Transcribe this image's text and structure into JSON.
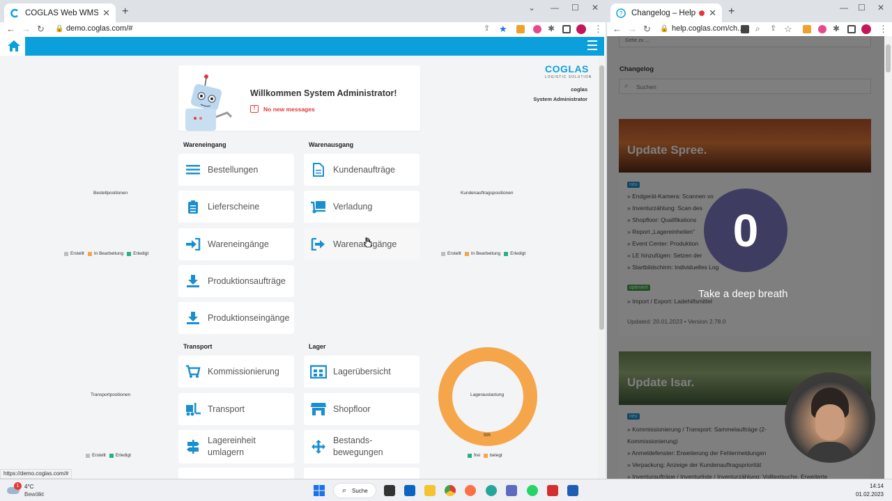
{
  "left_browser": {
    "tab_title": "COGLAS Web WMS",
    "url": "demo.coglas.com/#",
    "status_url": "https://demo.coglas.com/#"
  },
  "right_browser": {
    "tab_title": "Changelog – HelpCenter",
    "url": "help.coglas.com/ch..."
  },
  "welcome": {
    "title": "Willkommen System Administrator!",
    "messages": "No new messages"
  },
  "brand": {
    "logo": "COGLAS",
    "tagline": "LOGISTIC SOLUTION",
    "user": "coglas",
    "role": "System Administrator"
  },
  "sections": {
    "inbound": "Wareneingang",
    "outbound": "Warenausgang",
    "transport": "Transport",
    "storage": "Lager"
  },
  "tiles": {
    "bestellungen": "Bestellungen",
    "lieferscheine": "Lieferscheine",
    "wareneingaenge": "Wareneingänge",
    "produktionsauftraege": "Produktionsaufträge",
    "produktionseingaenge": "Produktionseingänge",
    "kundenauftraege": "Kundenaufträge",
    "verladung": "Verladung",
    "warenausgaenge": "Warenausgänge",
    "kommissionierung": "Kommissionierung",
    "transport": "Transport",
    "lageruebersicht": "Lagerübersicht",
    "shopfloor": "Shopfloor",
    "lagereinheit_umlagern": "Lagereinheit umlagern",
    "bestandsbewegungen": "Bestands-bewegungen"
  },
  "charts": {
    "bestellpositionen": {
      "label": "Bestellpositionen",
      "legend": [
        "Erstellt",
        "In Bearbeitung",
        "Erledigt"
      ]
    },
    "kundenauftragspositionen": {
      "label": "Kundenauftragspositionen",
      "legend": [
        "Erstellt",
        "In Bearbeitung",
        "Erledigt"
      ]
    },
    "transportpositionen": {
      "label": "Transportpositionen",
      "legend": [
        "Erstellt",
        "Erledigt"
      ]
    },
    "lagerauslastung": {
      "label": "Lagerauslastung",
      "value_label": "995",
      "legend": [
        "frei",
        "belegt"
      ]
    }
  },
  "chart_data": {
    "type": "pie",
    "title": "Lagerauslastung",
    "labels": [
      "frei",
      "belegt"
    ],
    "values": [
      0,
      995
    ],
    "colors": [
      "#26b08a",
      "#f5a54a"
    ]
  },
  "colors": {
    "accent": "#0ba0dc",
    "erstellt": "#bdbdbd",
    "in_bearbeitung": "#f5a54a",
    "erledigt": "#26b08a"
  },
  "help": {
    "goto_placeholder": "Gehe zu ...",
    "heading": "Changelog",
    "search_placeholder": "Suchen",
    "post1": {
      "title": "Update Spree.",
      "badge_new": "neu",
      "items": [
        "» Endgerät-Kamera: Scannen vo",
        "» Inventurzählung: Scan des",
        "» Shopfloor: Qualifikations",
        "» Report „Lagereinheiten\"",
        "» Event Center: Produktion",
        "» LE hinzufügen: Setzen der",
        "» Startbildschirm: Individuelles Log"
      ],
      "badge_opt": "optimiert",
      "opt_item": "» Import / Export: Ladehilfsmittel",
      "meta": "Updated: 20.01.2023 • Version 2.78.0"
    },
    "post2": {
      "title": "Update Isar.",
      "badge_new": "neu",
      "items": [
        "» Kommissionierung / Transport: Sammelaufträge (2-",
        "Kommissionierung)",
        "» Anmeldefenster: Erweiterung der Fehlermeldungen",
        "» Verpackung: Anzeige der Kundenauftragspriorität",
        "» Inventuraufträge / Inventurliste / Inventurzählung: Volltextsuche, Erweiterte"
      ]
    }
  },
  "overlay": {
    "counter": "0",
    "caption": "Take a deep breath"
  },
  "taskbar": {
    "weather_temp": "4°C",
    "weather_text": "Bewölkt",
    "search": "Suche",
    "time": "14:14",
    "date": "01.02.2023",
    "weather_badge": "1"
  }
}
